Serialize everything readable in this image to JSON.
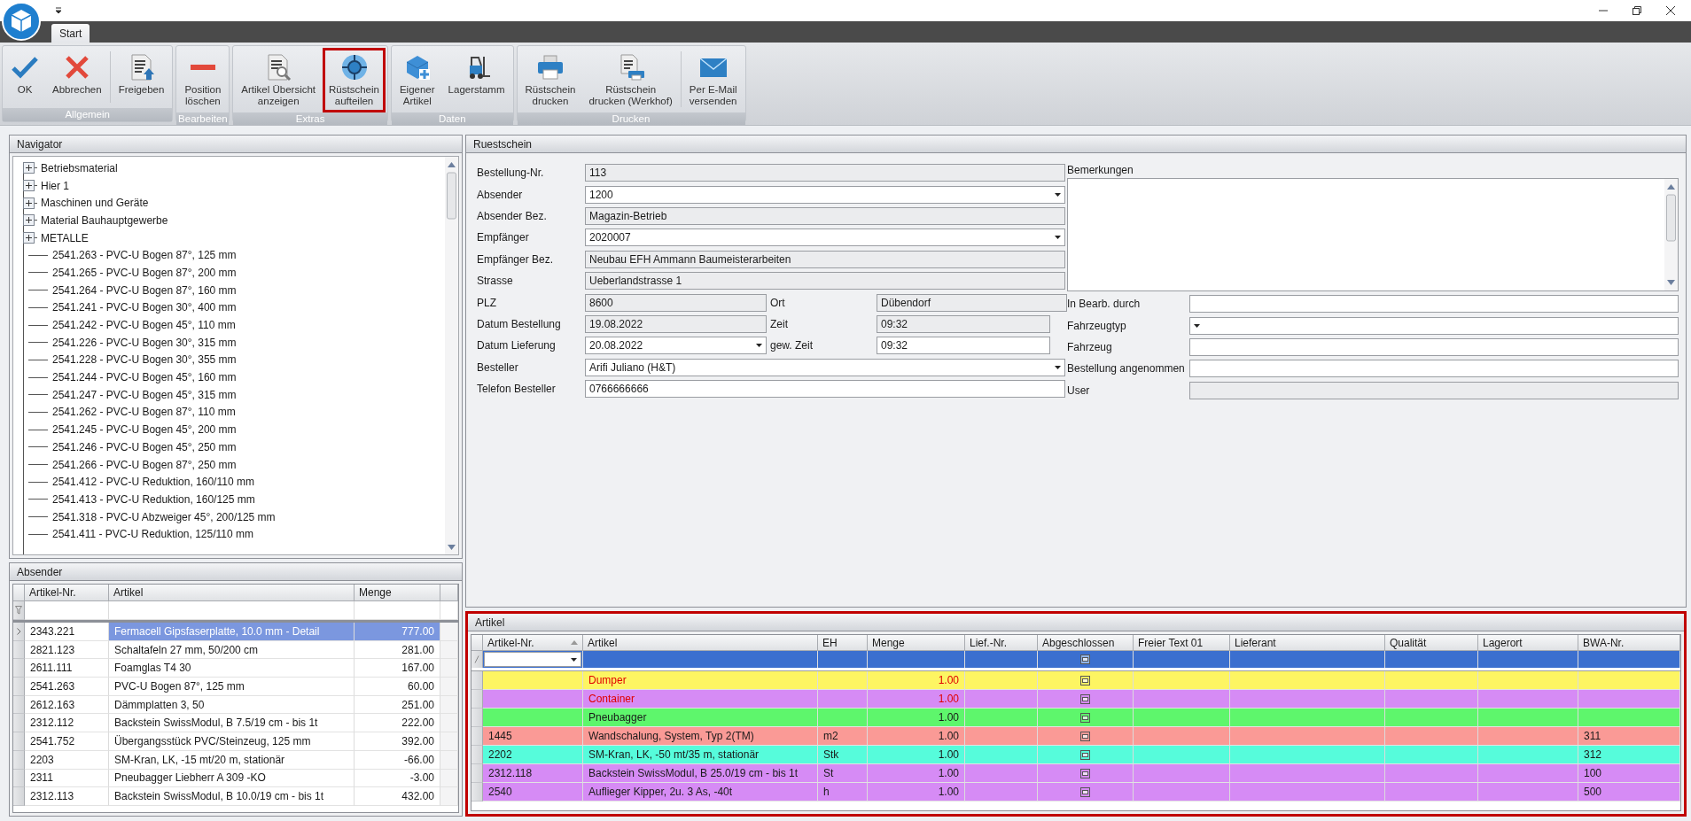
{
  "tabs": [
    {
      "label": "Start",
      "selected": true
    }
  ],
  "ribbon": {
    "groups": [
      {
        "label": "Allgemein",
        "buttons": [
          {
            "label": "OK",
            "highlighted": false
          },
          {
            "label": "Abbrechen",
            "highlighted": false
          },
          {
            "label": "Freigeben",
            "highlighted": false
          }
        ]
      },
      {
        "label": "Bearbeiten",
        "buttons": [
          {
            "label": "Position\nlöschen",
            "highlighted": false
          }
        ]
      },
      {
        "label": "Extras",
        "buttons": [
          {
            "label": "Artikel Übersicht\nanzeigen",
            "highlighted": false
          },
          {
            "label": "Rüstschein\naufteilen",
            "highlighted": true
          }
        ]
      },
      {
        "label": "Daten",
        "buttons": [
          {
            "label": "Eigener\nArtikel",
            "highlighted": false
          },
          {
            "label": "Lagerstamm",
            "highlighted": false
          }
        ]
      },
      {
        "label": "Drucken",
        "buttons": [
          {
            "label": "Rüstschein\ndrucken",
            "highlighted": false
          },
          {
            "label": "Rüstschein\ndrucken (Werkhof)",
            "highlighted": false
          },
          {
            "label": "Per E-Mail\nversenden",
            "highlighted": false
          }
        ]
      }
    ]
  },
  "navigator": {
    "title": "Navigator",
    "items": [
      {
        "label": "Betriebsmaterial",
        "kind": "group",
        "expanded": false
      },
      {
        "label": "Hier 1",
        "kind": "group",
        "expanded": false
      },
      {
        "label": "Maschinen und Geräte",
        "kind": "group",
        "expanded": false
      },
      {
        "label": "Material Bauhauptgewerbe",
        "kind": "group",
        "expanded": false
      },
      {
        "label": "METALLE",
        "kind": "group",
        "expanded": false
      },
      {
        "label": "2541.263 - PVC-U Bogen 87°, 125 mm"
      },
      {
        "label": "2541.265 - PVC-U Bogen 87°, 200 mm"
      },
      {
        "label": "2541.264 - PVC-U Bogen 87°, 160 mm"
      },
      {
        "label": "2541.241 - PVC-U Bogen 30°, 400 mm"
      },
      {
        "label": "2541.242 - PVC-U Bogen 45°, 110 mm"
      },
      {
        "label": "2541.226 - PVC-U Bogen 30°, 315 mm"
      },
      {
        "label": "2541.228 - PVC-U Bogen 30°, 355 mm"
      },
      {
        "label": "2541.244 - PVC-U Bogen 45°, 160 mm"
      },
      {
        "label": "2541.247 - PVC-U Bogen 45°, 315 mm"
      },
      {
        "label": "2541.262 - PVC-U Bogen 87°, 110 mm"
      },
      {
        "label": "2541.245 - PVC-U Bogen 45°, 200 mm"
      },
      {
        "label": "2541.246 - PVC-U Bogen 45°, 250 mm"
      },
      {
        "label": "2541.266 - PVC-U Bogen 87°, 250 mm"
      },
      {
        "label": "2541.412 - PVC-U Reduktion, 160/110 mm"
      },
      {
        "label": "2541.413 - PVC-U Reduktion, 160/125 mm"
      },
      {
        "label": "2541.318 - PVC-U Abzweiger 45°, 200/125 mm"
      },
      {
        "label": "2541.411 - PVC-U Reduktion, 125/110 mm"
      }
    ]
  },
  "absender": {
    "title": "Absender",
    "columns": [
      "Artikel-Nr.",
      "Artikel",
      "Menge"
    ],
    "rows": [
      {
        "nr": "2343.221",
        "artikel": "Fermacell Gipsfaserplatte, 10.0 mm - Detail",
        "menge": "777.00",
        "selected": true
      },
      {
        "nr": "2821.123",
        "artikel": "Schaltafeln 27 mm, 50/200 cm",
        "menge": "281.00",
        "selected": false
      },
      {
        "nr": "2611.111",
        "artikel": "Foamglas  T4   30",
        "menge": "167.00",
        "selected": false
      },
      {
        "nr": "2541.263",
        "artikel": "PVC-U Bogen 87°, 125 mm",
        "menge": "60.00",
        "selected": false
      },
      {
        "nr": "2612.163",
        "artikel": "Dämmplatten 3, 50",
        "menge": "251.00",
        "selected": false
      },
      {
        "nr": "2312.112",
        "artikel": "Backstein SwissModul, B 7.5/19 cm - bis 1t",
        "menge": "222.00",
        "selected": false
      },
      {
        "nr": "2541.752",
        "artikel": "Übergangsstück PVC/Steinzeug, 125 mm",
        "menge": "392.00",
        "selected": false
      },
      {
        "nr": "2203",
        "artikel": "SM-Kran, LK, -15 mt/20 m, stationär",
        "menge": "-66.00",
        "selected": false
      },
      {
        "nr": "2311",
        "artikel": "Pneubagger Liebherr A 309 -KO",
        "menge": "-3.00",
        "selected": false
      },
      {
        "nr": "2312.113",
        "artikel": "Backstein SwissModul, B 10.0/19 cm - bis 1t",
        "menge": "432.00",
        "selected": false
      }
    ]
  },
  "ruestschein": {
    "title": "Ruestschein",
    "fields": [
      {
        "label": "Bestellung-Nr.",
        "value": "113",
        "kind": "readonly"
      },
      {
        "label": "Absender",
        "value": "1200",
        "kind": "combo"
      },
      {
        "label": "Absender Bez.",
        "value": "Magazin-Betrieb",
        "kind": "readonly"
      },
      {
        "label": "Empfänger",
        "value": "2020007",
        "kind": "combo"
      },
      {
        "label": "Empfänger Bez.",
        "value": "Neubau EFH Ammann Baumeisterarbeiten",
        "kind": "readonly"
      },
      {
        "label": "Strasse",
        "value": "Ueberlandstrasse 1",
        "kind": "readonly"
      },
      {
        "label": "PLZ",
        "value": "8600",
        "kind": "readonly",
        "pair": {
          "label": "Ort",
          "value": "Dübendorf",
          "kind": "readonly"
        }
      },
      {
        "label": "Datum Bestellung",
        "value": "19.08.2022",
        "kind": "readonly",
        "pair": {
          "label": "Zeit",
          "value": "09:32",
          "kind": "readonly"
        }
      },
      {
        "label": "Datum Lieferung",
        "value": "20.08.2022",
        "kind": "combo",
        "pair": {
          "label": "gew. Zeit",
          "value": "09:32",
          "kind": "text"
        }
      },
      {
        "label": "Besteller",
        "value": "Arifi Juliano (H&T)",
        "kind": "combo"
      },
      {
        "label": "Telefon Besteller",
        "value": "0766666666",
        "kind": "text"
      }
    ],
    "remarks": {
      "label": "Bemerkungen"
    },
    "right_fields": [
      {
        "label": "In Bearb. durch",
        "kind": "text"
      },
      {
        "label": "Fahrzeugtyp",
        "kind": "combo"
      },
      {
        "label": "Fahrzeug",
        "kind": "text"
      },
      {
        "label": "Bestellung angenommen",
        "kind": "text"
      },
      {
        "label": "User",
        "kind": "readonly"
      }
    ]
  },
  "artikel": {
    "title": "Artikel",
    "highlighted": true,
    "columns": [
      {
        "label": "Artikel-Nr.",
        "sorted": true
      },
      {
        "label": "Artikel"
      },
      {
        "label": "EH"
      },
      {
        "label": "Menge"
      },
      {
        "label": "Lief.-Nr."
      },
      {
        "label": "Abgeschlossen"
      },
      {
        "label": "Freier Text 01"
      },
      {
        "label": "Lieferant"
      },
      {
        "label": "Qualität"
      },
      {
        "label": "Lagerort"
      },
      {
        "label": "BWA-Nr."
      }
    ],
    "new_row": {
      "selected": true,
      "abgeschlossen": false
    },
    "rows": [
      {
        "nr": "",
        "artikel": "Dumper",
        "eh": "",
        "menge": "1.00",
        "bwa": "",
        "abgeschlossen": false,
        "alert": true,
        "color": "#fdf562"
      },
      {
        "nr": "",
        "artikel": "Container",
        "eh": "",
        "menge": "1.00",
        "bwa": "",
        "abgeschlossen": false,
        "alert": true,
        "color": "#d68bf5"
      },
      {
        "nr": "",
        "artikel": "Pneubagger",
        "eh": "",
        "menge": "1.00",
        "bwa": "",
        "abgeschlossen": false,
        "alert": false,
        "color": "#5ef66c"
      },
      {
        "nr": "1445",
        "artikel": "Wandschalung, System, Typ 2(TM)",
        "eh": "m2",
        "menge": "1.00",
        "bwa": "311",
        "abgeschlossen": false,
        "alert": false,
        "color": "#fa9a96"
      },
      {
        "nr": "2202",
        "artikel": "SM-Kran, LK, -50 mt/35 m, stationär",
        "eh": "Stk",
        "menge": "1.00",
        "bwa": "312",
        "abgeschlossen": false,
        "alert": false,
        "color": "#56fcdb"
      },
      {
        "nr": "2312.118",
        "artikel": "Backstein SwissModul, B 25.0/19 cm - bis 1t",
        "eh": "St",
        "menge": "1.00",
        "bwa": "100",
        "abgeschlossen": false,
        "alert": false,
        "color": "#d68bf5"
      },
      {
        "nr": "2540",
        "artikel": "Auflieger Kipper, 2u. 3 As, -40t",
        "eh": "h",
        "menge": "1.00",
        "bwa": "500",
        "abgeschlossen": false,
        "alert": false,
        "color": "#d68bf5"
      }
    ]
  }
}
